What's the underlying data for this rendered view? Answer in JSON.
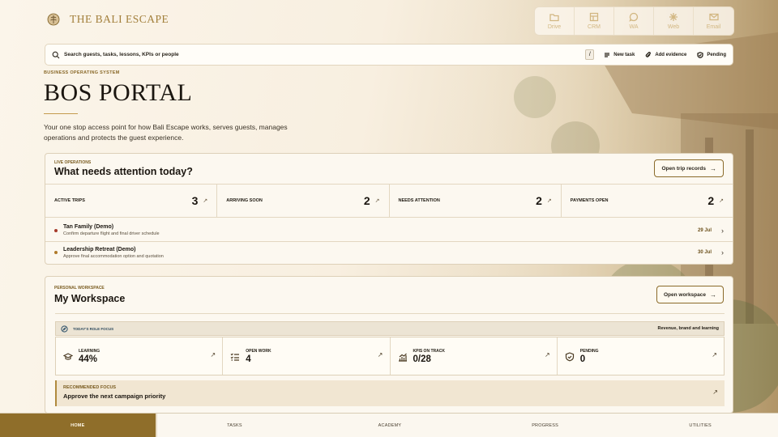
{
  "brand": {
    "name": "THE BALI ESCAPE"
  },
  "quick_links": [
    {
      "label": "Drive",
      "icon": "folder-icon"
    },
    {
      "label": "CRM",
      "icon": "grid-icon"
    },
    {
      "label": "WA",
      "icon": "chat-icon"
    },
    {
      "label": "Web",
      "icon": "sparkle-icon"
    },
    {
      "label": "Email",
      "icon": "mail-icon"
    }
  ],
  "search": {
    "placeholder": "Search guests, tasks, lessons, KPIs or people",
    "shortcut": "/",
    "actions": {
      "new_task": "New task",
      "add_evidence": "Add evidence",
      "pending": "Pending"
    }
  },
  "hero": {
    "eyebrow": "BUSINESS OPERATING SYSTEM",
    "title": "BOS PORTAL",
    "description": "Your one stop access point for how Bali Escape works, serves guests, manages operations and protects the guest experience."
  },
  "live_ops": {
    "eyebrow": "LIVE OPERATIONS",
    "title": "What needs attention today?",
    "button": "Open trip records",
    "stats": [
      {
        "label": "ACTIVE TRIPS",
        "value": "3"
      },
      {
        "label": "ARRIVING SOON",
        "value": "2"
      },
      {
        "label": "NEEDS ATTENTION",
        "value": "2"
      },
      {
        "label": "PAYMENTS OPEN",
        "value": "2"
      }
    ],
    "trips": [
      {
        "name": "Tan Family (Demo)",
        "note": "Confirm departure flight and final driver schedule",
        "date": "29 Jul",
        "dot_color": "#a63a2a"
      },
      {
        "name": "Leadership Retreat (Demo)",
        "note": "Approve final accommodation option and quotation",
        "date": "30 Jul",
        "dot_color": "#b07a2a"
      }
    ]
  },
  "workspace": {
    "eyebrow": "PERSONAL WORKSPACE",
    "title": "My Workspace",
    "button": "Open workspace",
    "role_focus_label": "TODAY'S ROLE FOCUS",
    "role_focus_value": "Revenue, brand and learning",
    "kpis": [
      {
        "label": "LEARNING",
        "value": "44%",
        "icon": "graduation-cap-icon"
      },
      {
        "label": "OPEN WORK",
        "value": "4",
        "icon": "checklist-icon"
      },
      {
        "label": "KPIS ON TRACK",
        "value": "0/28",
        "icon": "chart-icon"
      },
      {
        "label": "PENDING",
        "value": "0",
        "icon": "shield-check-icon"
      }
    ],
    "recommended_label": "RECOMMENDED FOCUS",
    "recommended_text": "Approve the next campaign priority"
  },
  "nav": [
    "HOME",
    "TASKS",
    "ACADEMY",
    "PROGRESS",
    "UTILITIES"
  ],
  "colors": {
    "accent": "#8f6e2a",
    "gold": "#a27f3b",
    "background": "#fbf5ea"
  }
}
